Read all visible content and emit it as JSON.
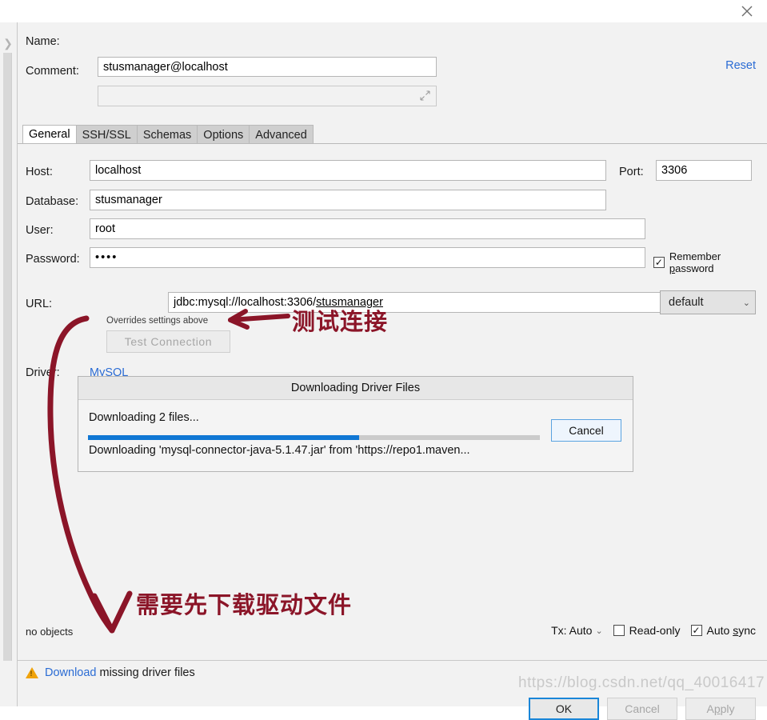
{
  "window": {
    "close_icon": "close-icon",
    "reset_label": "Reset"
  },
  "header": {
    "name_label": "Name:",
    "name_value": "stusmanager@localhost",
    "comment_label": "Comment:",
    "comment_value": "",
    "comment_placeholder": "",
    "expand_icon": "expand-diagonal-icon"
  },
  "tabs": [
    {
      "label": "General",
      "active": true
    },
    {
      "label": "SSH/SSL",
      "active": false
    },
    {
      "label": "Schemas",
      "active": false
    },
    {
      "label": "Options",
      "active": false
    },
    {
      "label": "Advanced",
      "active": false
    }
  ],
  "general": {
    "host_label": "Host:",
    "host_value": "localhost",
    "port_label": "Port:",
    "port_value": "3306",
    "database_label": "Database:",
    "database_value": "stusmanager",
    "user_label": "User:",
    "user_value": "root",
    "password_label": "Password:",
    "password_value": "••••",
    "remember_password_label_pre": "Remember ",
    "remember_password_label_key": "p",
    "remember_password_label_post": "assword",
    "remember_password_checked": "✓",
    "url_label": "URL:",
    "url_value": "jdbc:mysql://localhost:3306/",
    "url_value_underlined": "stusmanager",
    "url_hint": "Overrides settings above",
    "url_mode_value": "default",
    "url_mode_chevron": "⌄",
    "test_connection_label": "Test Connection",
    "driver_label": "Driver:",
    "driver_value": "MySQL"
  },
  "download_dialog": {
    "title": "Downloading Driver Files",
    "status_line": "Downloading 2 files...",
    "detail_line": "Downloading 'mysql-connector-java-5.1.47.jar' from 'https://repo1.maven...",
    "progress_percent": 60,
    "cancel_label": "Cancel"
  },
  "status_bar": {
    "no_objects_label": "no objects",
    "tx_label": "Tx: Auto",
    "tx_chevron": "⌄",
    "read_only_label": "Read-only",
    "read_only_checked": "",
    "auto_sync_label_pre": "Auto ",
    "auto_sync_label_key": "s",
    "auto_sync_label_post": "ync",
    "auto_sync_checked": "✓"
  },
  "warning": {
    "icon": "warning-triangle-icon",
    "link_label": "Download",
    "rest_label": "missing driver files"
  },
  "footer": {
    "ok_label": "OK",
    "cancel_label": "Cancel",
    "apply_label": "Apply"
  },
  "annotations": {
    "test_connection_note": "测试连接",
    "download_driver_note": "需要先下载驱动文件",
    "arrow_color": "#8b1528"
  },
  "watermark": {
    "text": "https://blog.csdn.net/qq_40016417"
  }
}
